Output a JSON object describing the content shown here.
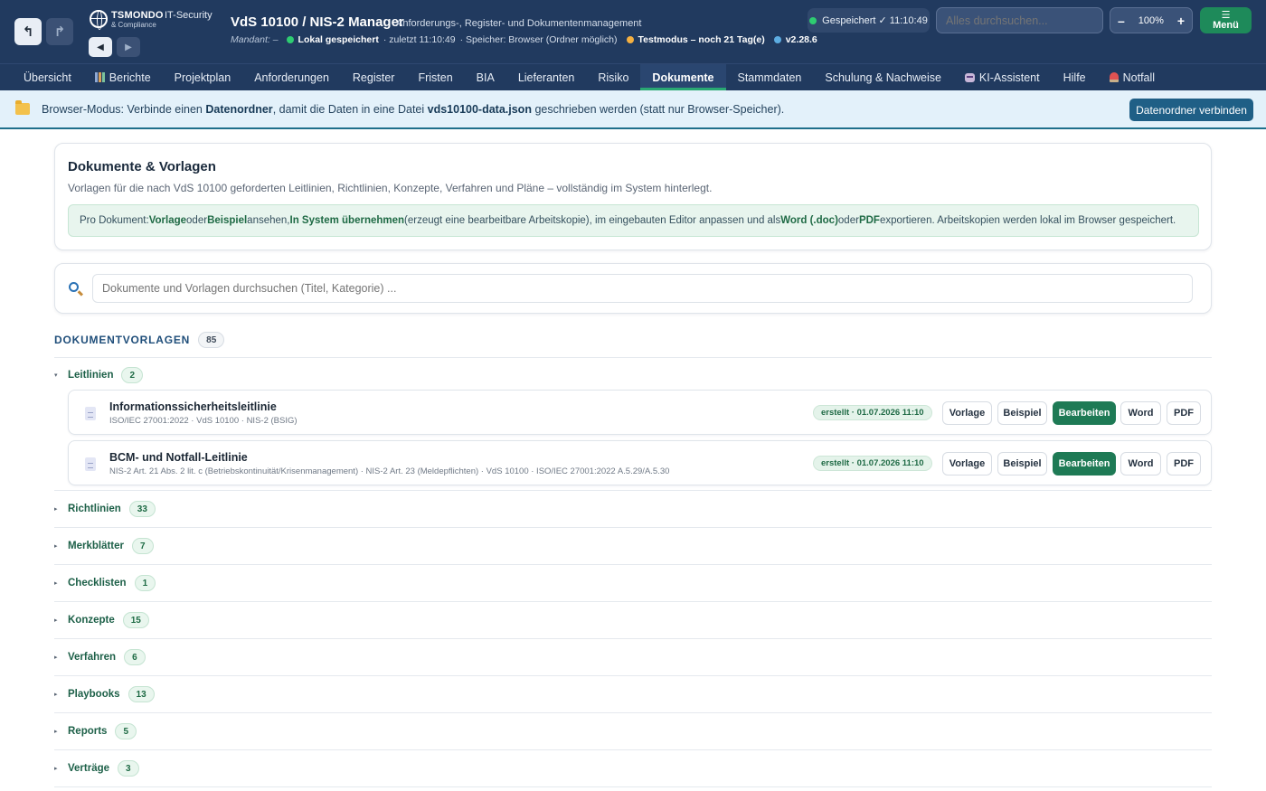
{
  "header": {
    "back_icon": "↰",
    "forward_icon": "↱",
    "prev_icon": "◀",
    "next_icon": "▶",
    "logo_name": "TSMONDO",
    "logo_sub": "& Compliance",
    "logo_it": "IT-Security",
    "title": "VdS 10100 / NIS-2 Manager",
    "subtitle": "Anforderungs-, Register- und Dokumentenmanagement",
    "mandant_label": "Mandant: –",
    "local_saved": "Lokal gespeichert",
    "last_saved": "· zuletzt 11:10:49",
    "storage": "· Speicher: Browser (Ordner möglich)",
    "testmode": "Testmodus – noch 21 Tag(e)",
    "version": "v2.28.6",
    "saved_pill": "Gespeichert ✓ 11:10:49",
    "search_placeholder": "Alles durchsuchen...",
    "zoom_minus": "–",
    "zoom_value": "100%",
    "zoom_plus": "+",
    "menu_icon": "☰",
    "menu_label": "Menü",
    "colors": {
      "bg": "#213a5f",
      "accent": "#1e8a5a",
      "green_dot": "#2ecc71",
      "orange_dot": "#f5b041",
      "blue_dot": "#5dade2"
    }
  },
  "nav": {
    "items": [
      {
        "label": "Übersicht"
      },
      {
        "label": "Berichte",
        "icon": "chart-icon"
      },
      {
        "label": "Projektplan"
      },
      {
        "label": "Anforderungen"
      },
      {
        "label": "Register"
      },
      {
        "label": "Fristen"
      },
      {
        "label": "BIA"
      },
      {
        "label": "Lieferanten"
      },
      {
        "label": "Risiko"
      },
      {
        "label": "Dokumente",
        "active": true
      },
      {
        "label": "Stammdaten"
      },
      {
        "label": "Schulung & Nachweise"
      },
      {
        "label": "KI-Assistent",
        "icon": "robot-icon"
      },
      {
        "label": "Hilfe"
      },
      {
        "label": "Notfall",
        "icon": "siren-icon"
      }
    ]
  },
  "banner": {
    "t1": "Browser-Modus: Verbinde einen ",
    "b1": "Datenordner",
    "t2": ", damit die Daten in eine Datei ",
    "b2": "vds10100-data.json",
    "t3": " geschrieben werden (statt nur Browser-Speicher).",
    "button": "Datenordner verbinden"
  },
  "intro": {
    "title": "Dokumente & Vorlagen",
    "description": "Vorlagen für die nach VdS 10100 geforderten Leitlinien, Richtlinien, Konzepte, Verfahren und Pläne – vollständig im System hinterlegt.",
    "hint": {
      "t1": "Pro Dokument: ",
      "b1": "Vorlage",
      "t2": " oder ",
      "b2": "Beispiel",
      "t3": " ansehen, ",
      "b3": "In System übernehmen",
      "t4": " (erzeugt eine bearbeitbare Arbeitskopie), im eingebauten Editor anpassen und als ",
      "b4": "Word (.doc)",
      "t5": " oder ",
      "b5": "PDF",
      "t6": " exportieren. Arbeitskopien werden lokal im Browser gespeichert."
    }
  },
  "search": {
    "placeholder": "Dokumente und Vorlagen durchsuchen (Titel, Kategorie) ..."
  },
  "templates": {
    "heading": "DOKUMENTVORLAGEN",
    "count": "85",
    "expanded_group": {
      "name": "Leitlinien",
      "count": "2",
      "chevron": "▾",
      "documents": [
        {
          "title": "Informationssicherheitsleitlinie",
          "meta": "ISO/IEC 27001:2022 · VdS 10100 · NIS-2 (BSIG)",
          "status": "erstellt · 01.07.2026 11:10",
          "buttons": {
            "vorlage": "Vorlage",
            "beispiel": "Beispiel",
            "bearbeiten": "Bearbeiten",
            "word": "Word",
            "pdf": "PDF"
          }
        },
        {
          "title": "BCM- und Notfall-Leitlinie",
          "meta": "NIS-2 Art. 21 Abs. 2 lit. c (Betriebskontinuität/Krisenmanagement) · NIS-2 Art. 23 (Meldepflichten) · VdS 10100 · ISO/IEC 27001:2022 A.5.29/A.5.30",
          "status": "erstellt · 01.07.2026 11:10",
          "buttons": {
            "vorlage": "Vorlage",
            "beispiel": "Beispiel",
            "bearbeiten": "Bearbeiten",
            "word": "Word",
            "pdf": "PDF"
          }
        }
      ]
    },
    "collapsed_groups": [
      {
        "name": "Richtlinien",
        "count": "33",
        "chevron": "▸"
      },
      {
        "name": "Merkblätter",
        "count": "7",
        "chevron": "▸"
      },
      {
        "name": "Checklisten",
        "count": "1",
        "chevron": "▸"
      },
      {
        "name": "Konzepte",
        "count": "15",
        "chevron": "▸"
      },
      {
        "name": "Verfahren",
        "count": "6",
        "chevron": "▸"
      },
      {
        "name": "Playbooks",
        "count": "13",
        "chevron": "▸"
      },
      {
        "name": "Reports",
        "count": "5",
        "chevron": "▸"
      },
      {
        "name": "Verträge",
        "count": "3",
        "chevron": "▸"
      }
    ]
  }
}
